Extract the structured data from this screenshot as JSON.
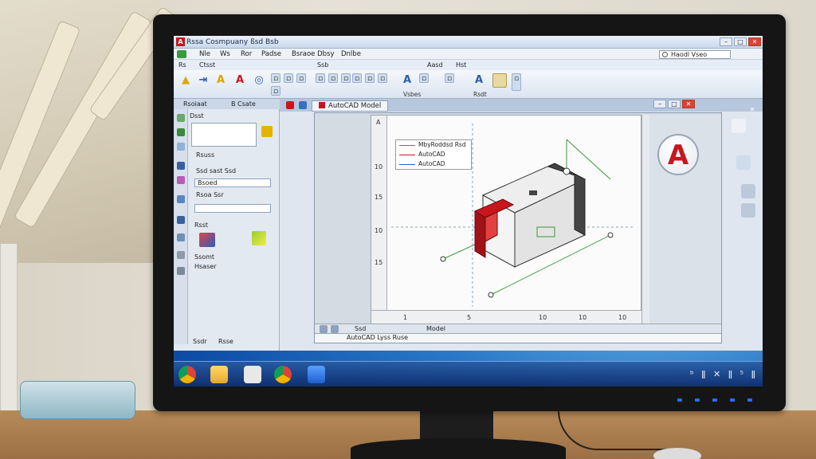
{
  "app": {
    "title": "Rssa Cosmpuany ßsd Bsb",
    "window_buttons": [
      "–",
      "□",
      "✕"
    ]
  },
  "menu": {
    "items": [
      "Nle",
      "Ws",
      "Ror",
      "Padse",
      "Bsraoe Dbsy",
      "Dnlbe"
    ],
    "search_value": "Haodl Vseo"
  },
  "ribbon": {
    "tabs": [
      "Rs",
      "Ctsst",
      "Ssb",
      "Aasd",
      "Hst"
    ],
    "groups": [
      "Vsbes",
      "Rsdt"
    ]
  },
  "palette": {
    "tabs": [
      "Rsoiaat",
      "B Csate"
    ],
    "rows": [
      "Dsst",
      "Rsuss",
      "Ssd sast Ssd",
      "Bsoed",
      "Rsoa Ssr",
      "Rsst",
      "Ssomt",
      "Hsaser"
    ],
    "bottom_buttons": [
      "Ssdr",
      "Rsse"
    ]
  },
  "document": {
    "tab_label": "AutoCAD Model",
    "ruler_left_top": "A",
    "ruler_numbers": [
      "10",
      "15",
      "10",
      "15",
      "1",
      "5",
      "10",
      "10",
      "10"
    ],
    "legend": [
      "MbyRoddsd Rsd",
      "AutoCAD",
      "AutoCAD"
    ],
    "model_tabs": [
      "Ssd",
      "Model"
    ],
    "command_line": "AutoCAD Lyss Ruse",
    "logo_letter": "A"
  },
  "taskbar": {
    "tray_text": "ᵇ ǁ ✕ ǁ ⁵ ǁ"
  },
  "colors": {
    "accent_red": "#c8161d",
    "screen_blue": "#2a79c7",
    "window_bg": "#dfe6ef"
  }
}
